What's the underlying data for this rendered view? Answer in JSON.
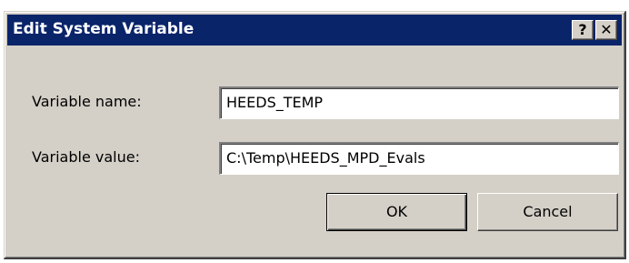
{
  "window": {
    "title": "Edit System Variable",
    "help_glyph": "?",
    "close_glyph": "✕"
  },
  "form": {
    "name_label": "Variable name:",
    "name_value": "HEEDS_TEMP",
    "value_label": "Variable value:",
    "value_value": "C:\\Temp\\HEEDS_MPD_Evals"
  },
  "buttons": {
    "ok_label": "OK",
    "cancel_label": "Cancel"
  },
  "colors": {
    "titlebar": "#0a246a",
    "face": "#d4d0c8"
  }
}
